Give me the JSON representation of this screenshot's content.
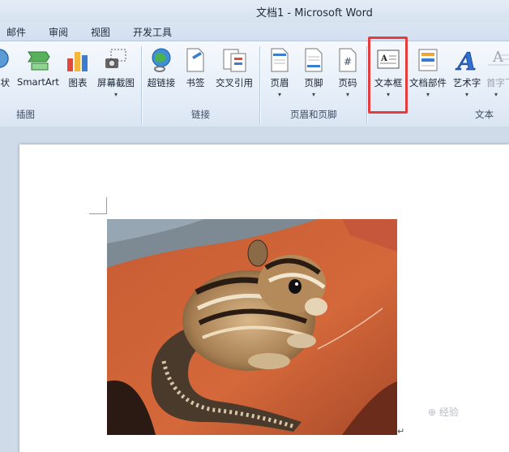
{
  "window": {
    "title": "文档1  -  Microsoft Word"
  },
  "menu_tabs": [
    "邮件",
    "审阅",
    "视图",
    "开发工具"
  ],
  "ribbon": {
    "partial_left_label": "状",
    "insert_illustrations": {
      "smartart": "SmartArt",
      "chart": "图表",
      "screenshot": "屏幕截图",
      "group_label": "插图"
    },
    "links": {
      "hyperlink": "超链接",
      "bookmark": "书签",
      "crossref": "交叉引用",
      "group_label": "链接"
    },
    "header_footer": {
      "header": "页眉",
      "footer": "页脚",
      "page_number": "页码",
      "group_label": "页眉和页脚"
    },
    "text": {
      "textbox": "文本框",
      "quickparts": "文档部件",
      "wordart": "艺术字",
      "dropcap": "首字下",
      "group_label": "文本"
    },
    "dropdown_glyph": "▾"
  },
  "document": {
    "paragraph_mark": "↵"
  },
  "watermark": {
    "text": "⊕ 经验"
  },
  "colors": {
    "highlight": "#e53c3c"
  }
}
